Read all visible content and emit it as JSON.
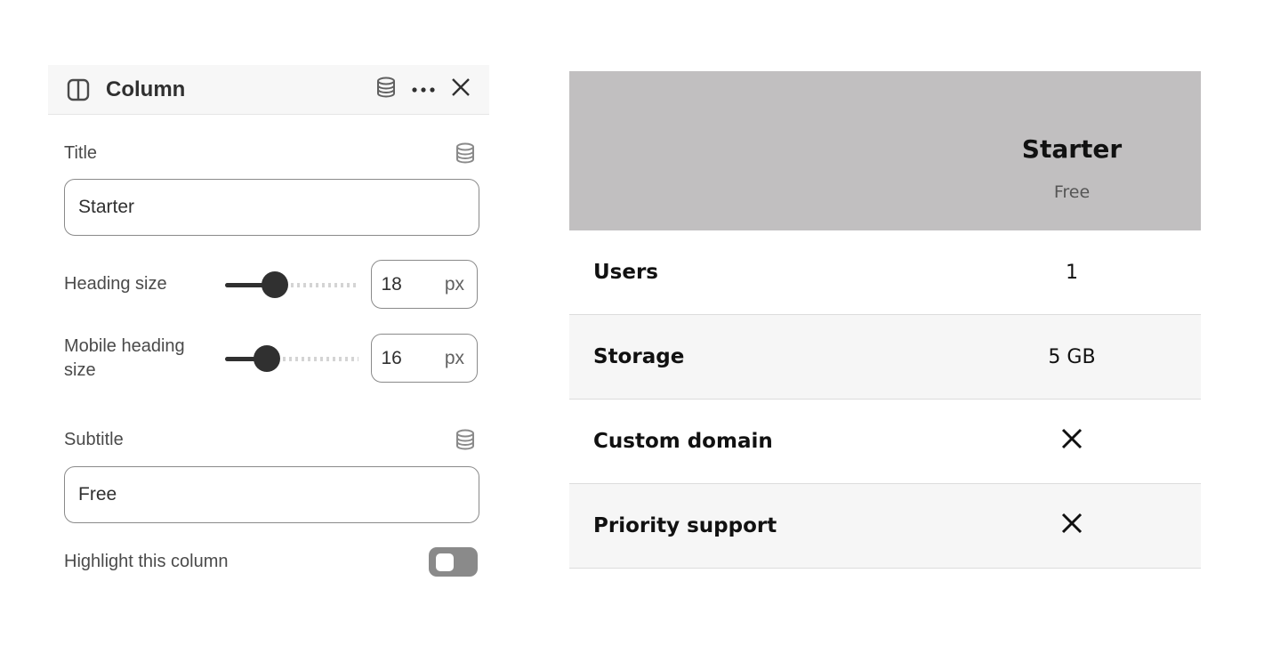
{
  "panel": {
    "title": "Column",
    "icons": {
      "column": "column-layout-icon",
      "database": "database-icon",
      "more": "more-horizontal-icon",
      "close": "close-icon"
    },
    "title_field": {
      "label": "Title",
      "value": "Starter"
    },
    "heading_size": {
      "label": "Heading size",
      "value": "18",
      "unit": "px",
      "slider_fraction": 0.27
    },
    "mobile_heading_size": {
      "label": "Mobile heading size",
      "value": "16",
      "unit": "px",
      "slider_fraction": 0.21
    },
    "subtitle_field": {
      "label": "Subtitle",
      "value": "Free"
    },
    "highlight": {
      "label": "Highlight this column",
      "on": false
    }
  },
  "preview": {
    "column_title": "Starter",
    "column_subtitle": "Free",
    "rows": [
      {
        "feature": "Users",
        "value": "1"
      },
      {
        "feature": "Storage",
        "value": "5 GB"
      },
      {
        "feature": "Custom domain",
        "value": "✕"
      },
      {
        "feature": "Priority support",
        "value": "✕"
      }
    ],
    "colors": {
      "header_bg": "#c1bfc0",
      "alt_row_bg": "#f6f6f6"
    }
  }
}
